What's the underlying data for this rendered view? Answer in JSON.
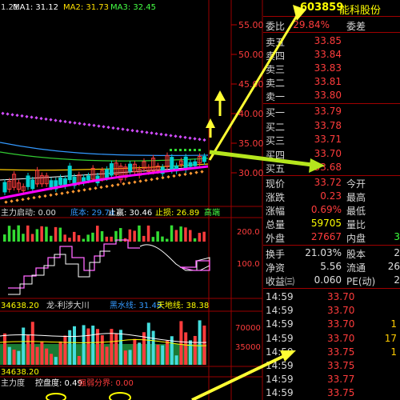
{
  "header": {
    "ma_prefix": "1.21",
    "ma1": "MA1: 31.12",
    "ma2": "MA2: 31.73",
    "ma3": "MA3: 32.45",
    "stock_code": "603859",
    "stock_name": "能科股份"
  },
  "price_axis": [
    "55.00",
    "50.00",
    "45.00",
    "40.00",
    "35.00",
    "30.00"
  ],
  "indicator1": {
    "name": "主力启动: 0.00",
    "lbl1": "底本: 29.74",
    "lbl2": "止赢: 30.46",
    "lbl3": "止损: 26.89",
    "lbl4": "高端",
    "axis": [
      "200.0",
      "100.0"
    ]
  },
  "indicator2": {
    "lbl0": "34638.20",
    "name": "龙-利涉大川",
    "lbl1": "黑水线: 31.48",
    "lbl2": "天地线: 38.38",
    "axis": [
      "70000",
      "35000"
    ]
  },
  "indicator3": {
    "lbl0": "34638.20",
    "name": "主力度",
    "lbl1": "控盘度: 0.49",
    "lbl2": "强弱分界: 0.00"
  },
  "order_book": {
    "weibi_label": "委比",
    "weibi_value": "29.84%",
    "weicha_label": "委差",
    "asks": [
      {
        "label": "卖五",
        "price": "33.85"
      },
      {
        "label": "卖四",
        "price": "33.84"
      },
      {
        "label": "卖三",
        "price": "33.83"
      },
      {
        "label": "卖二",
        "price": "33.81"
      },
      {
        "label": "卖一",
        "price": "33.80"
      }
    ],
    "bids": [
      {
        "label": "买一",
        "price": "33.79"
      },
      {
        "label": "买二",
        "price": "33.78"
      },
      {
        "label": "买三",
        "price": "33.71"
      },
      {
        "label": "买四",
        "price": "33.70"
      },
      {
        "label": "买五",
        "price": "33.68"
      }
    ]
  },
  "quote": {
    "xianjia_label": "现价",
    "xianjia": "33.72",
    "jinkai_label": "今开",
    "zhangdie_label": "涨跌",
    "zhangdie": "0.23",
    "zuigao_label": "最高",
    "zhangfu_label": "涨幅",
    "zhangfu": "0.69%",
    "zuidi_label": "最低",
    "zongliang_label": "总量",
    "zongliang": "59705",
    "liangbi_label": "量比",
    "waipan_label": "外盘",
    "waipan": "27667",
    "neipan_label": "内盘",
    "neipan_tail": "3",
    "huanshou_label": "换手",
    "huanshou": "21.03%",
    "guben_label": "股本",
    "guben_tail": "2",
    "jingzi_label": "净资",
    "jingzi": "5.56",
    "liutong_label": "流通",
    "liutong_tail": "26",
    "shouyi_label": "收益㈢",
    "shouyi": "0.060",
    "pe_label": "PE(动)",
    "pe_tail": "2"
  },
  "ticks": [
    {
      "time": "14:59",
      "price": "33.70",
      "vol": ""
    },
    {
      "time": "14:59",
      "price": "33.70",
      "vol": ""
    },
    {
      "time": "14:59",
      "price": "33.70",
      "vol": "1"
    },
    {
      "time": "14:59",
      "price": "33.70",
      "vol": "17"
    },
    {
      "time": "14:59",
      "price": "33.75",
      "vol": "1"
    },
    {
      "time": "14:59",
      "price": "33.75",
      "vol": ""
    },
    {
      "time": "14:59",
      "price": "33.77",
      "vol": ""
    },
    {
      "time": "14:59",
      "price": "33.75",
      "vol": ""
    }
  ],
  "colors": {
    "up": "#ff3c3c",
    "down": "#00d0d0",
    "grid": "#9a0000",
    "yellow": "#ffff00",
    "arrow": "#ffff33",
    "arrow_green": "#b5e61d",
    "ma1": "#ffffff",
    "ma2": "#ffe000",
    "ma3": "#ff44ff",
    "magenta": "#ff00ff"
  },
  "chart_data": {
    "type": "candlestick",
    "price_axis": [
      30,
      35,
      40,
      45,
      50,
      55
    ],
    "last_price": 33.72,
    "volume_axis": [
      35000,
      70000
    ],
    "indicator_axis": [
      100,
      200
    ]
  }
}
